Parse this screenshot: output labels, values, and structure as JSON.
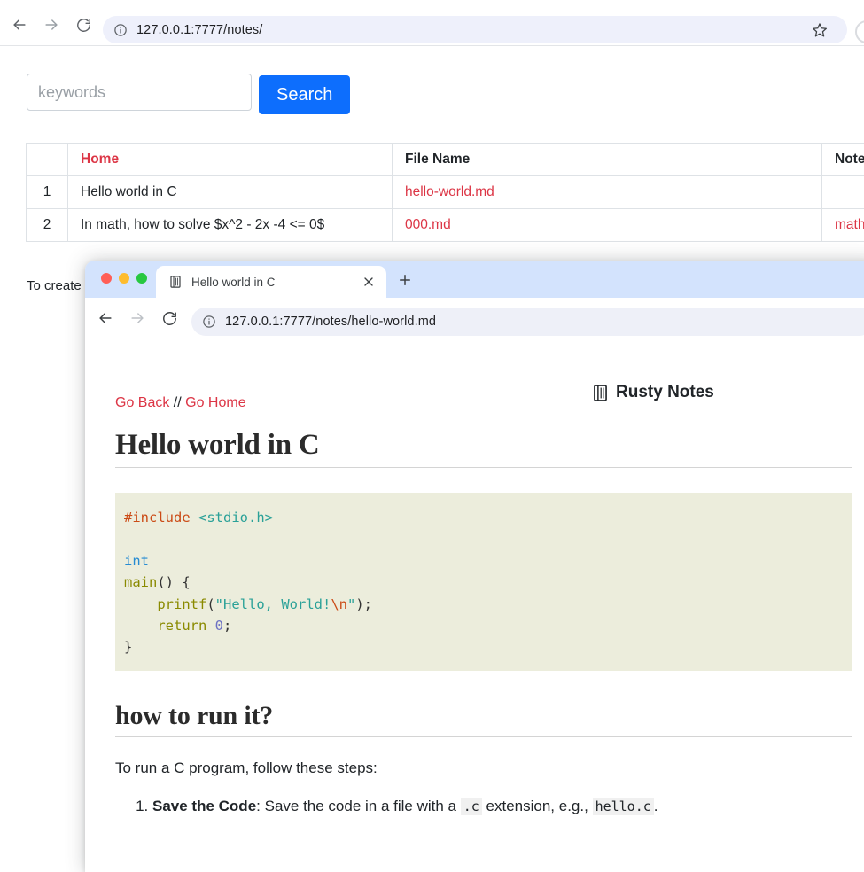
{
  "outer_browser": {
    "url": "127.0.0.1:7777/notes/",
    "back_icon": "arrow-left-icon",
    "forward_icon": "arrow-right-icon",
    "reload_icon": "reload-icon",
    "site_info_icon": "info-circle-icon",
    "star_icon": "star-bookmark-icon",
    "profile_icon": "profile-avatar-icon"
  },
  "search": {
    "value": "",
    "placeholder": "keywords",
    "button_label": "Search",
    "accent_color": "#0d6efd"
  },
  "notes_table": {
    "headers": [
      "",
      "Home",
      "File Name",
      "Note"
    ],
    "rows": [
      {
        "index": "1",
        "home": "Hello world in C",
        "file_name": "hello-world.md",
        "note": ""
      },
      {
        "index": "2",
        "home": "In math, how to solve $x^2 - 2x -4 <= 0$",
        "file_name": "000.md",
        "note": "math"
      }
    ],
    "link_color": "#dc3545"
  },
  "outer_footnote": "To create n",
  "inner_browser": {
    "tab": {
      "favicon": "notebook-icon",
      "title": "Hello world in C",
      "close_icon": "close-x-icon"
    },
    "new_tab_icon": "plus-icon",
    "url": "127.0.0.1:7777/notes/hello-world.md",
    "back_icon": "arrow-left-icon",
    "forward_icon": "arrow-right-icon",
    "reload_icon": "reload-icon",
    "site_info_icon": "info-circle-icon",
    "traffic_lights": {
      "close_color": "#ff5f57",
      "minimize_color": "#febc2e",
      "maximize_color": "#28c840"
    },
    "tabstrip_color": "#d3e3fd"
  },
  "note_page": {
    "nav": {
      "go_back": "Go Back",
      "separator": " // ",
      "go_home": "Go Home"
    },
    "brand": {
      "icon": "notebook-icon",
      "text": "Rusty Notes"
    },
    "title": "Hello world in C",
    "code": {
      "language": "c",
      "background": "#eceddc",
      "tokens": [
        {
          "text": "#include",
          "type": "preprocessor",
          "color": "#cb4b16"
        },
        {
          "text": " ",
          "type": "plain",
          "color": "#333333"
        },
        {
          "text": "<stdio.h>",
          "type": "include-path",
          "color": "#2aa198"
        },
        {
          "text": "\n\n",
          "type": "plain",
          "color": "#333333"
        },
        {
          "text": "int",
          "type": "type",
          "color": "#268bd2"
        },
        {
          "text": "\n",
          "type": "plain",
          "color": "#333333"
        },
        {
          "text": "main",
          "type": "function",
          "color": "#8a8a00"
        },
        {
          "text": "() {",
          "type": "plain",
          "color": "#333333"
        },
        {
          "text": "\n    ",
          "type": "plain",
          "color": "#333333"
        },
        {
          "text": "printf",
          "type": "function",
          "color": "#8a8a00"
        },
        {
          "text": "(",
          "type": "plain",
          "color": "#333333"
        },
        {
          "text": "\"Hello, World!",
          "type": "string",
          "color": "#2aa198"
        },
        {
          "text": "\\n",
          "type": "escape",
          "color": "#cb4b16"
        },
        {
          "text": "\"",
          "type": "string",
          "color": "#2aa198"
        },
        {
          "text": ");",
          "type": "plain",
          "color": "#333333"
        },
        {
          "text": "\n    ",
          "type": "plain",
          "color": "#333333"
        },
        {
          "text": "return",
          "type": "keyword",
          "color": "#8a8a00"
        },
        {
          "text": " ",
          "type": "plain",
          "color": "#333333"
        },
        {
          "text": "0",
          "type": "number",
          "color": "#6c71c4"
        },
        {
          "text": ";",
          "type": "plain",
          "color": "#333333"
        },
        {
          "text": "\n}",
          "type": "plain",
          "color": "#333333"
        }
      ],
      "plain_text": "#include <stdio.h>\n\nint\nmain() {\n    printf(\"Hello, World!\\n\");\n    return 0;\n}"
    },
    "section_heading": "how to run it?",
    "intro_paragraph": "To run a C program, follow these steps:",
    "steps": [
      {
        "number": "1.",
        "bold": "Save the Code",
        "text_before_code1": ": Save the code in a file with a ",
        "code1": ".c",
        "text_between": " extension, e.g., ",
        "code2": "hello.c",
        "text_after": "."
      }
    ]
  }
}
